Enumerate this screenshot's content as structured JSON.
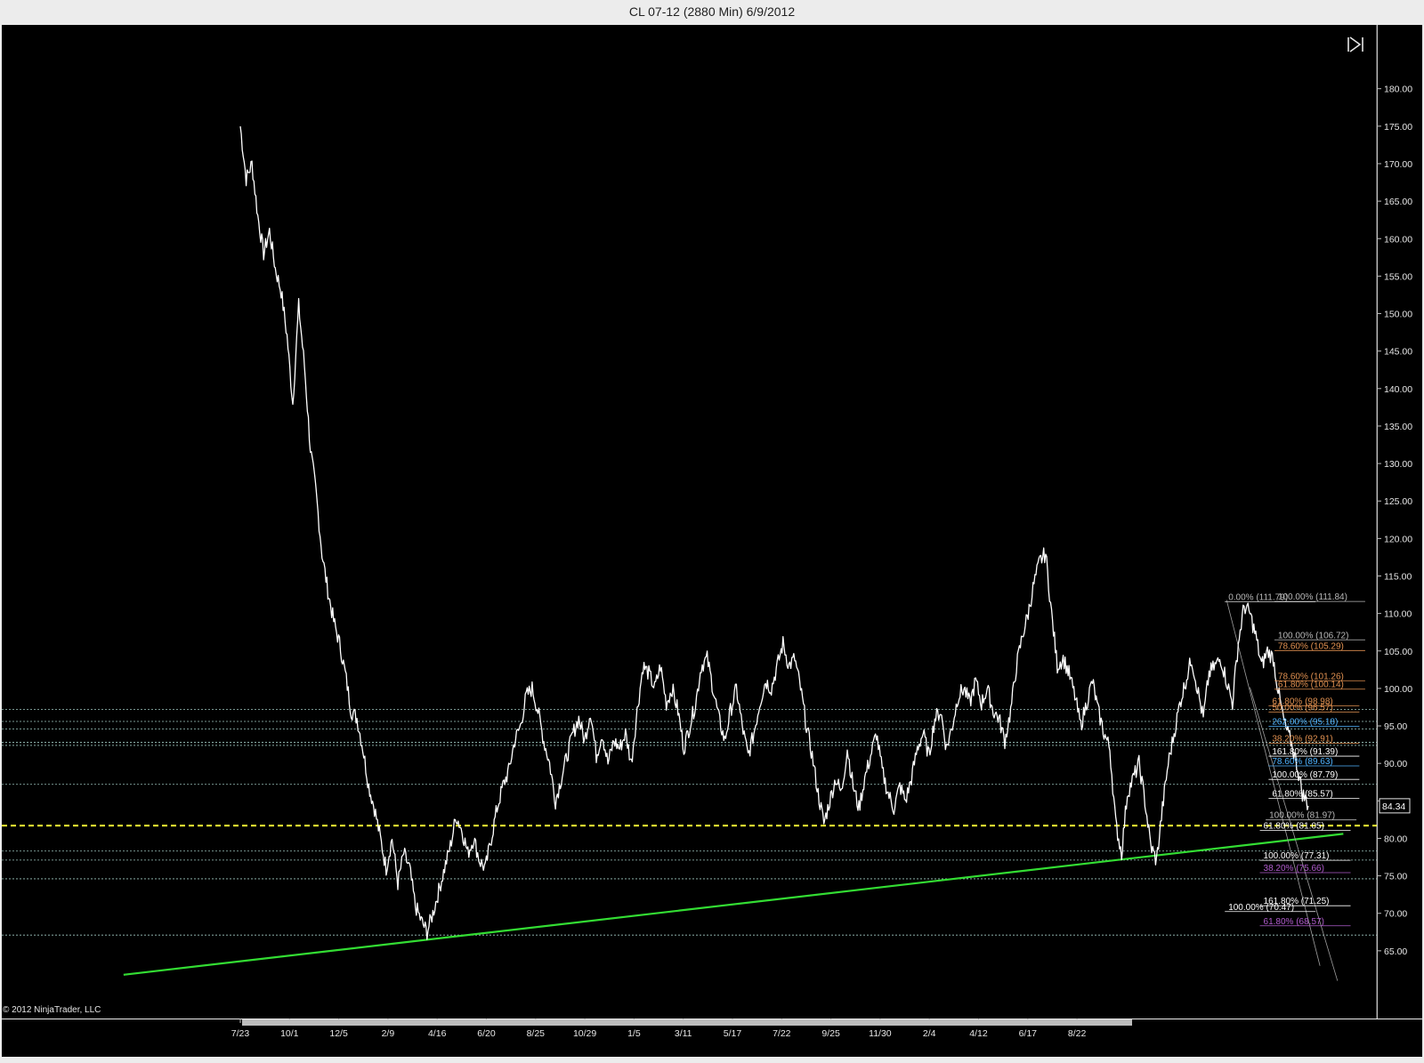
{
  "window": {
    "title": "CL 07-12 (2880 Min)  6/9/2012"
  },
  "copyright": "© 2012 NinjaTrader, LLC",
  "colors": {
    "background": "#000000",
    "price": "#ffffff",
    "trendline": "#33dd33",
    "horizontal_dashed": "#9ec7c0",
    "current_level": "#ffff33",
    "fib_gray": "#b8b8b8",
    "fib_orange": "#e09050",
    "fib_blue": "#4fb3ff",
    "fib_purple": "#b05ccc",
    "fib_white": "#ffffff"
  },
  "icons": {
    "scroll_end": "scroll-to-end-icon"
  },
  "chart_data": {
    "type": "line",
    "title": "CL 07-12 (2880 Min)  6/9/2012",
    "ylim": [
      60,
      184
    ],
    "y_ticks": [
      65,
      70,
      75,
      80,
      85,
      90,
      95,
      100,
      105,
      110,
      115,
      120,
      125,
      130,
      135,
      140,
      145,
      150,
      155,
      160,
      165,
      170,
      175,
      180
    ],
    "y_tick_labels": [
      "65.00",
      "70.00",
      "75.00",
      "80.00",
      "85.00",
      "90.00",
      "95.00",
      "100.00",
      "105.00",
      "110.00",
      "115.00",
      "120.00",
      "125.00",
      "130.00",
      "135.00",
      "140.00",
      "145.00",
      "150.00",
      "155.00",
      "160.00",
      "165.00",
      "170.00",
      "175.00",
      "180.00"
    ],
    "x_tick_labels": [
      "7/23",
      "10/1",
      "12/5",
      "2/9",
      "4/16",
      "6/20",
      "8/25",
      "10/29",
      "1/5",
      "3/11",
      "5/17",
      "7/22",
      "9/25",
      "11/30",
      "2/4",
      "4/12",
      "6/17",
      "8/22"
    ],
    "last_price_label": "84.34",
    "last_price": 84.34,
    "series": [
      {
        "values": [
          [
            0,
            175
          ],
          [
            2,
            168
          ],
          [
            4,
            170
          ],
          [
            6,
            163
          ],
          [
            8,
            158
          ],
          [
            10,
            161
          ],
          [
            12,
            156
          ],
          [
            14,
            153
          ],
          [
            16,
            147
          ],
          [
            18,
            138
          ],
          [
            20,
            151
          ],
          [
            22,
            143
          ],
          [
            24,
            132
          ],
          [
            26,
            126
          ],
          [
            28,
            118
          ],
          [
            30,
            113
          ],
          [
            32,
            109
          ],
          [
            34,
            106
          ],
          [
            36,
            102
          ],
          [
            38,
            97
          ],
          [
            40,
            96
          ],
          [
            42,
            92
          ],
          [
            44,
            87
          ],
          [
            46,
            84
          ],
          [
            48,
            80
          ],
          [
            50,
            76
          ],
          [
            52,
            80
          ],
          [
            54,
            74
          ],
          [
            56,
            78
          ],
          [
            58,
            76
          ],
          [
            60,
            71
          ],
          [
            62,
            69
          ],
          [
            64,
            67.5
          ],
          [
            66,
            70
          ],
          [
            68,
            73
          ],
          [
            70,
            76
          ],
          [
            72,
            79
          ],
          [
            74,
            83
          ],
          [
            76,
            81
          ],
          [
            78,
            78
          ],
          [
            80,
            80
          ],
          [
            82,
            77
          ],
          [
            84,
            76
          ],
          [
            86,
            80
          ],
          [
            88,
            84
          ],
          [
            90,
            87
          ],
          [
            92,
            89
          ],
          [
            94,
            93
          ],
          [
            96,
            95
          ],
          [
            98,
            99
          ],
          [
            100,
            100
          ],
          [
            102,
            97
          ],
          [
            104,
            93
          ],
          [
            106,
            90
          ],
          [
            108,
            85
          ],
          [
            110,
            88
          ],
          [
            112,
            91
          ],
          [
            114,
            94
          ],
          [
            116,
            96
          ],
          [
            118,
            93
          ],
          [
            120,
            97
          ],
          [
            122,
            91
          ],
          [
            124,
            94
          ],
          [
            126,
            90
          ],
          [
            128,
            93
          ],
          [
            130,
            92
          ],
          [
            132,
            94
          ],
          [
            134,
            90
          ],
          [
            136,
            97
          ],
          [
            138,
            103
          ],
          [
            140,
            102
          ],
          [
            142,
            100
          ],
          [
            144,
            103
          ],
          [
            146,
            98
          ],
          [
            148,
            100
          ],
          [
            150,
            97
          ],
          [
            152,
            92
          ],
          [
            154,
            95
          ],
          [
            156,
            98
          ],
          [
            158,
            103
          ],
          [
            160,
            104
          ],
          [
            162,
            100
          ],
          [
            164,
            96
          ],
          [
            166,
            93
          ],
          [
            168,
            97
          ],
          [
            170,
            100
          ],
          [
            172,
            95
          ],
          [
            174,
            91
          ],
          [
            176,
            94
          ],
          [
            178,
            98
          ],
          [
            180,
            101
          ],
          [
            182,
            100
          ],
          [
            184,
            103
          ],
          [
            186,
            106
          ],
          [
            188,
            103
          ],
          [
            190,
            104
          ],
          [
            192,
            100
          ],
          [
            194,
            95
          ],
          [
            196,
            91
          ],
          [
            198,
            86
          ],
          [
            200,
            82
          ],
          [
            202,
            85
          ],
          [
            204,
            88
          ],
          [
            206,
            86
          ],
          [
            208,
            92
          ],
          [
            210,
            87
          ],
          [
            212,
            84
          ],
          [
            214,
            88
          ],
          [
            216,
            91
          ],
          [
            218,
            94
          ],
          [
            220,
            89
          ],
          [
            222,
            86
          ],
          [
            224,
            84
          ],
          [
            226,
            87
          ],
          [
            228,
            85
          ],
          [
            230,
            88
          ],
          [
            232,
            92
          ],
          [
            234,
            94
          ],
          [
            236,
            91
          ],
          [
            238,
            96
          ],
          [
            240,
            97
          ],
          [
            242,
            92
          ],
          [
            244,
            95
          ],
          [
            246,
            99
          ],
          [
            248,
            100
          ],
          [
            250,
            98
          ],
          [
            252,
            101
          ],
          [
            254,
            98
          ],
          [
            256,
            100
          ],
          [
            258,
            97
          ],
          [
            260,
            96
          ],
          [
            262,
            93
          ],
          [
            264,
            97
          ],
          [
            266,
            103
          ],
          [
            268,
            107
          ],
          [
            270,
            110
          ],
          [
            272,
            114
          ],
          [
            274,
            117
          ],
          [
            276,
            118
          ],
          [
            278,
            110
          ],
          [
            280,
            103
          ],
          [
            282,
            104
          ],
          [
            284,
            102
          ],
          [
            286,
            99
          ],
          [
            288,
            95
          ],
          [
            290,
            98
          ],
          [
            292,
            101
          ],
          [
            294,
            97
          ],
          [
            296,
            94
          ],
          [
            298,
            92
          ],
          [
            300,
            82
          ],
          [
            302,
            78
          ],
          [
            304,
            86
          ],
          [
            306,
            88
          ],
          [
            308,
            90
          ],
          [
            310,
            85
          ],
          [
            312,
            79
          ],
          [
            314,
            77
          ],
          [
            316,
            84
          ],
          [
            318,
            90
          ],
          [
            320,
            94
          ],
          [
            322,
            98
          ],
          [
            324,
            101
          ],
          [
            326,
            104
          ],
          [
            328,
            100
          ],
          [
            330,
            96
          ],
          [
            332,
            102
          ],
          [
            334,
            103
          ],
          [
            336,
            104
          ],
          [
            338,
            101
          ],
          [
            340,
            98
          ],
          [
            342,
            106
          ],
          [
            344,
            111
          ],
          [
            346,
            110
          ],
          [
            348,
            107
          ],
          [
            350,
            103
          ],
          [
            352,
            105
          ],
          [
            354,
            104
          ],
          [
            356,
            99
          ],
          [
            358,
            95
          ],
          [
            360,
            93
          ],
          [
            362,
            90
          ],
          [
            364,
            86
          ],
          [
            366,
            84.34
          ]
        ]
      }
    ],
    "x_domain": [
      0,
      366
    ],
    "trendline": {
      "from": [
        -40,
        61.8
      ],
      "to": [
        378,
        80.6
      ]
    },
    "horizontal_levels": [
      {
        "value": 97.2,
        "style": "dashed",
        "color": "horizontal_dashed"
      },
      {
        "value": 95.6,
        "style": "dashed",
        "color": "horizontal_dashed"
      },
      {
        "value": 94.6,
        "style": "dashed",
        "color": "horizontal_dashed"
      },
      {
        "value": 92.8,
        "style": "dashed",
        "color": "horizontal_dashed"
      },
      {
        "value": 92.4,
        "style": "dashed",
        "color": "horizontal_dashed"
      },
      {
        "value": 87.2,
        "style": "dashed",
        "color": "horizontal_dashed"
      },
      {
        "value": 81.7,
        "style": "dashed",
        "color": "current_level"
      },
      {
        "value": 78.3,
        "style": "dashed",
        "color": "horizontal_dashed"
      },
      {
        "value": 77.1,
        "style": "dashed",
        "color": "horizontal_dashed"
      },
      {
        "value": 74.6,
        "style": "dashed",
        "color": "horizontal_dashed"
      },
      {
        "value": 67.1,
        "style": "dashed",
        "color": "horizontal_dashed"
      }
    ],
    "annotations": [
      {
        "text": "0.00% (111.79)",
        "value": 111.79,
        "x": 338,
        "color": "fib_gray"
      },
      {
        "text": "100.00% (111.84)",
        "value": 111.84,
        "x": 355,
        "color": "fib_gray"
      },
      {
        "text": "100.00% (106.72)",
        "value": 106.72,
        "x": 355,
        "color": "fib_gray"
      },
      {
        "text": "78.60% (105.29)",
        "value": 105.29,
        "x": 355,
        "color": "fib_orange"
      },
      {
        "text": "78.60% (101.26)",
        "value": 101.26,
        "x": 355,
        "color": "fib_orange"
      },
      {
        "text": "61.80% (100.14)",
        "value": 100.14,
        "x": 355,
        "color": "fib_orange"
      },
      {
        "text": "61.80% (98.98)",
        "value": 97.9,
        "x": 353,
        "color": "fib_orange"
      },
      {
        "text": "50.00% (96.57)",
        "value": 97.1,
        "x": 353,
        "color": "fib_orange"
      },
      {
        "text": "262.00% (95.18)",
        "value": 95.18,
        "x": 353,
        "color": "fib_blue"
      },
      {
        "text": "38.20% (92.91)",
        "value": 92.91,
        "x": 353,
        "color": "fib_orange"
      },
      {
        "text": "161.80% (91.39)",
        "value": 91.2,
        "x": 353,
        "color": "fib_white"
      },
      {
        "text": "78.60% (89.63)",
        "value": 89.9,
        "x": 353,
        "color": "fib_blue"
      },
      {
        "text": "100.00% (87.79)",
        "value": 88.1,
        "x": 353,
        "color": "fib_white"
      },
      {
        "text": "61.80% (85.57)",
        "value": 85.57,
        "x": 353,
        "color": "fib_white"
      },
      {
        "text": "100.00% (81.97)",
        "value": 82.7,
        "x": 352,
        "color": "fib_gray"
      },
      {
        "text": "61.80% (81.05)",
        "value": 81.3,
        "x": 350,
        "color": "fib_white"
      },
      {
        "text": "100.00% (77.31)",
        "value": 77.31,
        "x": 350,
        "color": "fib_white"
      },
      {
        "text": "38.20% (75.66)",
        "value": 75.66,
        "x": 350,
        "color": "fib_purple"
      },
      {
        "text": "161.80% (71.25)",
        "value": 71.25,
        "x": 350,
        "color": "fib_white"
      },
      {
        "text": "100.00% (70.47)",
        "value": 70.47,
        "x": 338,
        "color": "fib_white"
      },
      {
        "text": "61.80% (68.57)",
        "value": 68.57,
        "x": 350,
        "color": "fib_purple"
      }
    ]
  }
}
